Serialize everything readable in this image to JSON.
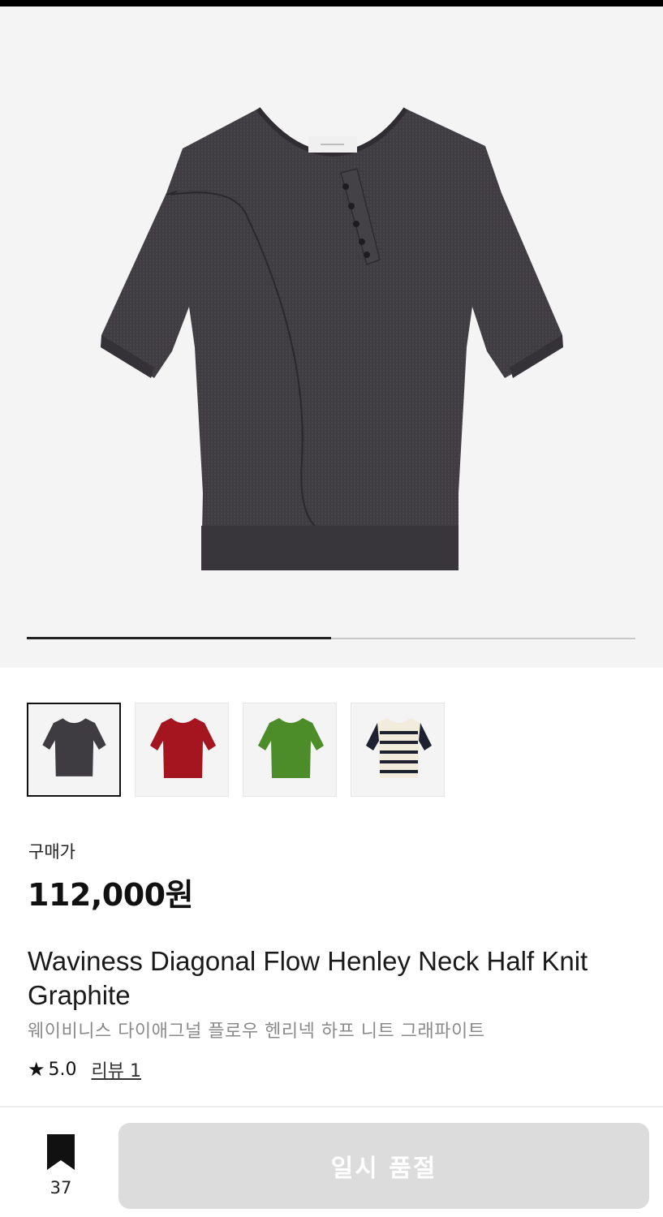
{
  "gallery": {
    "main_image": "graphite-henley-knit-photo",
    "progress": 0.5,
    "thumbnails": [
      {
        "name": "thumb-graphite",
        "color": "#3e3c40",
        "selected": true
      },
      {
        "name": "thumb-red",
        "color": "#a5151f",
        "selected": false
      },
      {
        "name": "thumb-green",
        "color": "#4c8d2a",
        "selected": false
      },
      {
        "name": "thumb-stripe",
        "color": "#1e2230",
        "selected": false
      }
    ]
  },
  "product": {
    "price_label": "구매가",
    "price": "112,000원",
    "name_en": "Waviness Diagonal Flow Henley Neck Half Knit Graphite",
    "name_ko": "웨이비니스 다이애그널 플로우 헨리넥 하프 니트 그래파이트",
    "rating_icon": "star-icon",
    "rating": "5.0",
    "review_link": "리뷰 1"
  },
  "footer": {
    "bookmark_icon": "bookmark-icon",
    "bookmark_count": "37",
    "button_label": "일시 품절"
  }
}
